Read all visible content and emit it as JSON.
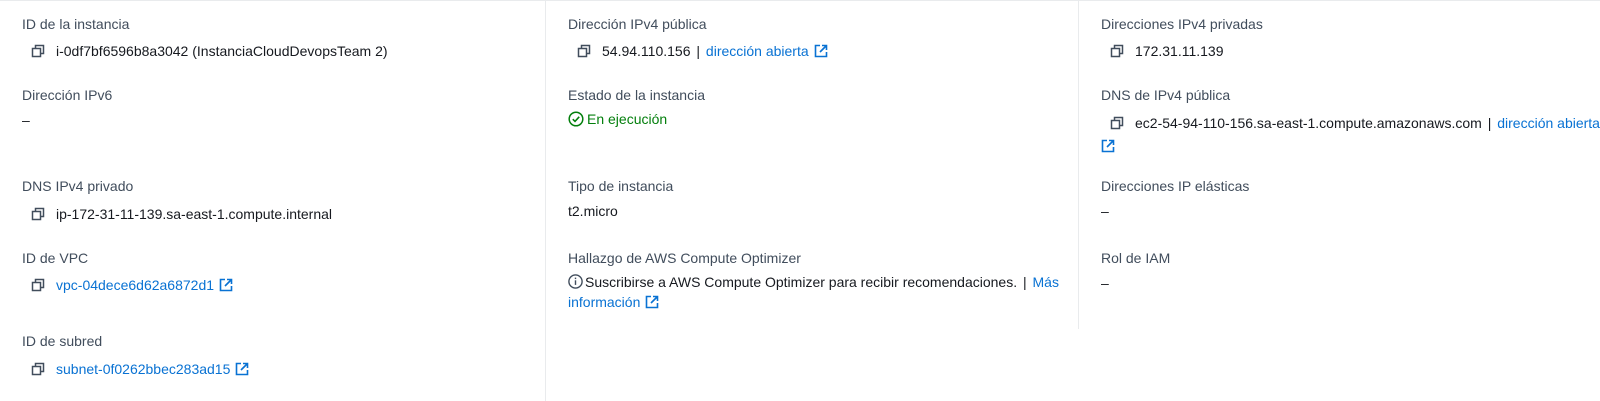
{
  "instance_id": {
    "label": "ID de la instancia",
    "value": "i-0df7bf6596b8a3042 (InstanciaCloudDevopsTeam 2)"
  },
  "public_ipv4": {
    "label": "Dirección IPv4 pública",
    "value": "54.94.110.156",
    "separator": "|",
    "link": "dirección abierta"
  },
  "private_ipv4": {
    "label": "Direcciones IPv4 privadas",
    "value": "172.31.11.139"
  },
  "ipv6": {
    "label": "Dirección IPv6",
    "value": "–"
  },
  "instance_state": {
    "label": "Estado de la instancia",
    "value": "En ejecución",
    "color": "#037f0c"
  },
  "public_dns": {
    "label": "DNS de IPv4 pública",
    "value": "ec2-54-94-110-156.sa-east-1.compute.amazonaws.com",
    "separator": "|",
    "link": "dirección abierta"
  },
  "private_dns": {
    "label": "DNS IPv4 privado",
    "value": "ip-172-31-11-139.sa-east-1.compute.internal"
  },
  "instance_type": {
    "label": "Tipo de instancia",
    "value": "t2.micro"
  },
  "elastic_ip": {
    "label": "Direcciones IP elásticas",
    "value": "–"
  },
  "vpc_id": {
    "label": "ID de VPC",
    "value": "vpc-04dece6d62a6872d1"
  },
  "compute_optimizer": {
    "label": "Hallazgo de AWS Compute Optimizer",
    "message": "Suscribirse a AWS Compute Optimizer para recibir recomendaciones.",
    "separator": "|",
    "link_part1": "Más",
    "link_part2": "información"
  },
  "iam_role": {
    "label": "Rol de IAM",
    "value": "–"
  },
  "subnet_id": {
    "label": "ID de subred",
    "value": "subnet-0f0262bbec283ad15"
  },
  "colors": {
    "link": "#0972d3",
    "label": "#414d5c",
    "text": "#16191f",
    "success": "#037f0c",
    "divider": "#e9ebed"
  },
  "icons": [
    "copy-icon",
    "external-link-icon",
    "status-success-icon",
    "info-icon"
  ]
}
